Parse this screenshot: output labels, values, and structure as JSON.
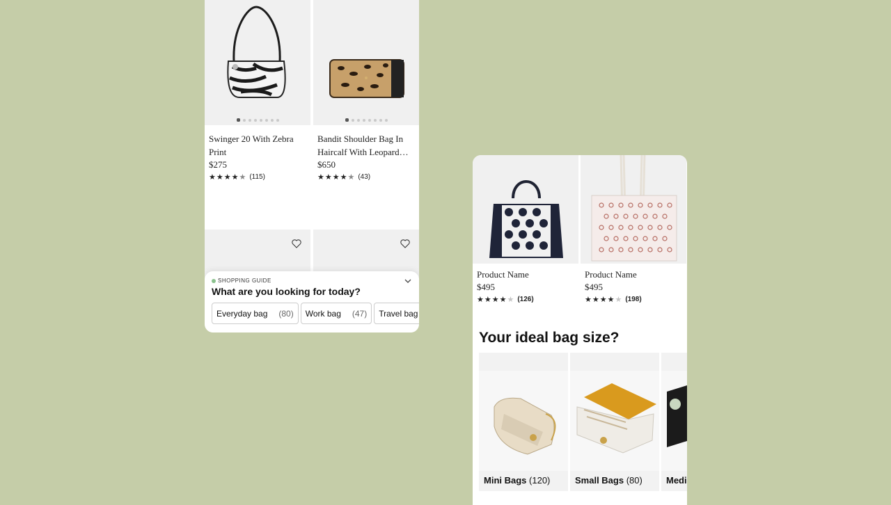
{
  "left_panel": {
    "products": [
      {
        "name": "Swinger 20 With Zebra Print",
        "price": "$275",
        "rating_count": "(115)",
        "stars": 4.5
      },
      {
        "name": "Bandit Shoulder Bag In Haircalf With Leopard…",
        "price": "$650",
        "rating_count": "(43)",
        "stars": 4.5
      }
    ],
    "shopping_guide": {
      "tag": "SHOPPING GUIDE",
      "title": "What are you looking for today?",
      "chips": [
        {
          "label": "Everyday bag",
          "count": "(80)"
        },
        {
          "label": "Work bag",
          "count": "(47)"
        },
        {
          "label": "Travel bag",
          "count": ""
        }
      ]
    }
  },
  "right_panel": {
    "products": [
      {
        "name": "Product Name",
        "price": "$495",
        "rating_count": "(126)",
        "stars": 4
      },
      {
        "name": "Product Name",
        "price": "$495",
        "rating_count": "(198)",
        "stars": 4
      }
    ],
    "size_section": {
      "title": "Your ideal bag size?",
      "cards": [
        {
          "label": "Mini Bags",
          "count": "(120)"
        },
        {
          "label": "Small Bags",
          "count": "(80)"
        },
        {
          "label": "Medi",
          "count": ""
        }
      ]
    }
  },
  "colors": {
    "background": "#c5cda8",
    "accent_dot": "#8bc28e"
  }
}
